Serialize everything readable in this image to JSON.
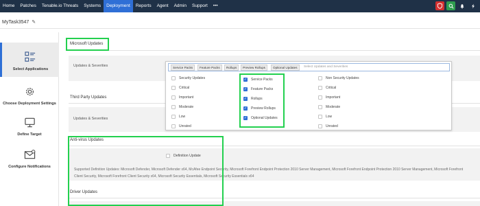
{
  "nav": {
    "items": [
      "Home",
      "Patches",
      "Tenable.io Threats",
      "Systems",
      "Deployment",
      "Reports",
      "Agent",
      "Admin",
      "Support"
    ],
    "active": "Deployment",
    "more_glyph": "•••",
    "accent_color": "#2f6fd6",
    "bar_color": "#1f3147",
    "right_icons": [
      "shield-icon",
      "search-icon",
      "bell-icon",
      "bolt-icon"
    ]
  },
  "task": {
    "title": "MyTask3547"
  },
  "steps": [
    {
      "label": "Select Applications",
      "icon": "grid-list-icon",
      "active": true
    },
    {
      "label": "Choose Deployment Settings",
      "icon": "gear-icon",
      "active": false
    },
    {
      "label": "Define Target",
      "icon": "monitor-icon",
      "active": false
    },
    {
      "label": "Configure Notifications",
      "icon": "envelope-icon",
      "active": false
    }
  ],
  "sections": {
    "microsoft": {
      "title": "Microsoft Updates",
      "row_label": "Updates & Severities"
    },
    "third_party": {
      "title": "Third Party Updates",
      "row_label": "Updates & Severities"
    },
    "antivirus": {
      "title": "Anti-virus Updates",
      "definition_label": "Definition Update",
      "supported_text": "Supported Definition Updates: Microsoft Defender, Microsoft Defender x64, McAfee Endpoint Security, Microsoft Forefront Endpoint Protection 2010 Server Management, Microsoft Forefront Endpoint Protection 2010 Server Management, Microsoft Forefront Client Security, Microsoft Forefront Client Security x64, Microsoft Security Essentials, Microsoft Security Essentials x64"
    },
    "driver": {
      "title": "Driver Updates"
    }
  },
  "dropdown": {
    "chips": [
      "Service Packs",
      "Feature Packs",
      "Rollups",
      "Preview Rollups",
      "Optional Updates"
    ],
    "placeholder": "Select Updates and Severities",
    "security": {
      "header": "Security Updates",
      "items": [
        "Critical",
        "Important",
        "Moderate",
        "Low",
        "Unrated"
      ]
    },
    "types": {
      "items": [
        "Service Packs",
        "Feature Packs",
        "Rollups",
        "Preview Rollups",
        "Optional Updates"
      ],
      "checked": [
        true,
        true,
        true,
        true,
        true
      ]
    },
    "non_security": {
      "header": "Non Security Updates",
      "items": [
        "Critical",
        "Important",
        "Moderate",
        "Low",
        "Unrated"
      ]
    }
  },
  "highlight_color": "#22d04e"
}
